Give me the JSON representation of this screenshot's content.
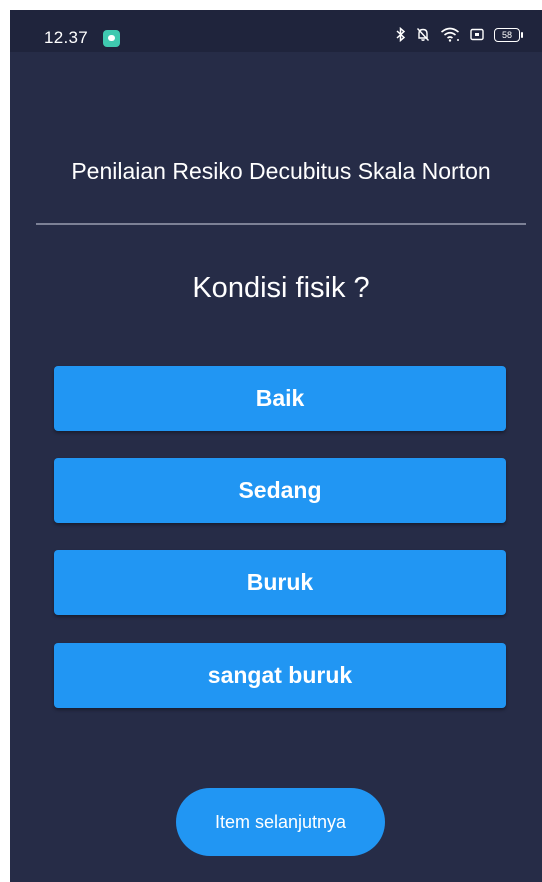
{
  "status_bar": {
    "time": "12.37",
    "notification_icon": "chat-notification-icon",
    "icons": [
      "bluetooth-icon",
      "bell-off-icon",
      "wifi-icon",
      "screen-cast-icon",
      "battery-icon"
    ],
    "battery_level": "58"
  },
  "page": {
    "title": "Penilaian Resiko Decubitus Skala Norton",
    "question": "Kondisi fisik ?"
  },
  "answers": [
    {
      "label": "Baik"
    },
    {
      "label": "Sedang"
    },
    {
      "label": "Buruk"
    },
    {
      "label": "sangat buruk"
    }
  ],
  "next_button": {
    "label": "Item selanjutnya"
  },
  "colors": {
    "background": "#262c47",
    "status_bar": "#1f243c",
    "button": "#2196f3",
    "divider": "#7c8196",
    "text": "#ffffff"
  }
}
